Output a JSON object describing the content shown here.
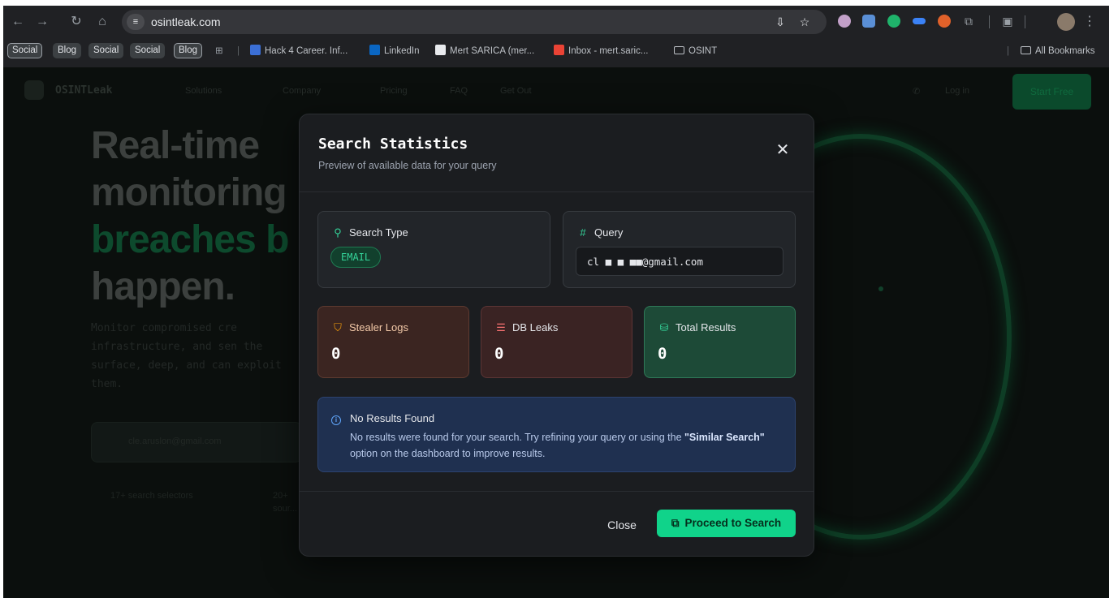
{
  "browser": {
    "url": "osintleak.com",
    "nav_icons": [
      "back-icon",
      "forward-icon",
      "reload-icon",
      "home-icon"
    ],
    "bookmarks": {
      "chips": [
        "Social",
        "Blog",
        "Social",
        "Social",
        "Blog"
      ],
      "items": [
        "Hack 4 Career. Inf...",
        "LinkedIn",
        "Mert SARICA (mer...",
        "Inbox - mert.saric...",
        "OSINT"
      ],
      "all_bookmarks": "All Bookmarks"
    }
  },
  "website": {
    "brand": "OSINTLeak",
    "nav_links": [
      "Solutions",
      "Company",
      "Pricing",
      "FAQ",
      "Get Out"
    ],
    "login": "Log in",
    "start": "Start Free",
    "hero_title_line1": "Real-time",
    "hero_title_line2": "monitoring",
    "hero_title_green": "breaches b",
    "hero_title_line4": "happen.",
    "hero_desc": "Monitor compromised cre infrastructure, and sen the surface, deep, and can exploit them.",
    "hero_search_placeholder": "cle.aruslon@gmail.com",
    "hero_stat_1": "17+ search selectors",
    "hero_stat_2": "20+ sour..."
  },
  "modal": {
    "title": "Search Statistics",
    "subtitle": "Preview of available data for your query",
    "search_type": {
      "label": "Search Type",
      "value": "EMAIL"
    },
    "query": {
      "label": "Query",
      "value": "cl  ■  ■ ■■@gmail.com"
    },
    "stats": [
      {
        "label": "Stealer Logs",
        "value": "0"
      },
      {
        "label": "DB Leaks",
        "value": "0"
      },
      {
        "label": "Total Results",
        "value": "0"
      }
    ],
    "notice": {
      "title": "No Results Found",
      "body_pre": "No results were found for your search. Try refining your query or using the ",
      "body_bold": "\"Similar Search\"",
      "body_post": " option on the dashboard to improve results."
    },
    "close_label": "Close",
    "proceed_label": "Proceed to Search"
  },
  "colors": {
    "accent": "#10d38a",
    "modal_bg": "#1b1d20",
    "notice_bg": "#1f3050",
    "stealer_bg": "#3b2521",
    "db_bg": "#3a2323",
    "total_bg": "#1d4a37"
  }
}
